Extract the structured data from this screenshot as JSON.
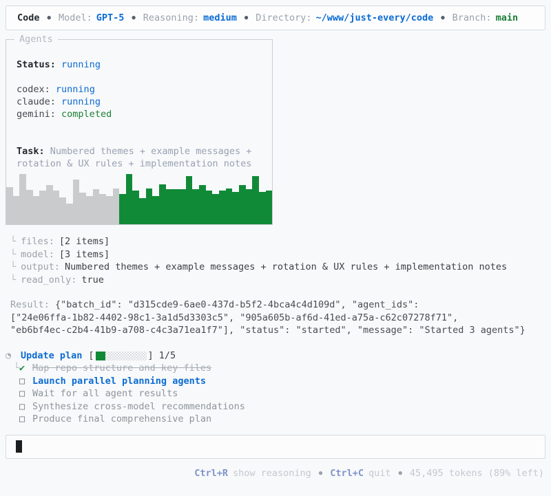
{
  "topbar": {
    "app": "Code",
    "sep": "●",
    "model_label": "Model:",
    "model_value": "GPT-5",
    "reasoning_label": "Reasoning:",
    "reasoning_value": "medium",
    "directory_label": "Directory:",
    "directory_value": "~/www/just-every/code",
    "branch_label": "Branch:",
    "branch_value": "main"
  },
  "agents_panel": {
    "title": "Agents",
    "status_label": "Status:",
    "status_value": "running",
    "agents": [
      {
        "name": "codex:",
        "status": "running"
      },
      {
        "name": "claude:",
        "status": "running"
      },
      {
        "name": "gemini:",
        "status": "completed"
      }
    ],
    "task_label": "Task:",
    "task_text": "Numbered themes + example messages + rotation & UX rules + implementation notes"
  },
  "chart_data": {
    "type": "bar",
    "title": "agent activity sparkline",
    "values": [
      68,
      52,
      92,
      63,
      52,
      62,
      72,
      62,
      50,
      38,
      82,
      58,
      52,
      64,
      56,
      52,
      66,
      56,
      92,
      62,
      48,
      66,
      52,
      74,
      64,
      64,
      64,
      88,
      64,
      72,
      62,
      56,
      62,
      66,
      60,
      72,
      64,
      88,
      60,
      62
    ],
    "split_index": 17,
    "bar_colors": {
      "past": "#c9cbcd",
      "recent": "#118a38"
    },
    "ylim": [
      0,
      100
    ],
    "xlabel": "",
    "ylabel": ""
  },
  "tree": {
    "glyph": "└",
    "items": [
      {
        "key": "files:",
        "value": "[2 items]"
      },
      {
        "key": "model:",
        "value": "[3 items]"
      },
      {
        "key": "output:",
        "value": "Numbered themes + example messages + rotation & UX rules + implementation notes"
      },
      {
        "key": "read_only:",
        "value": "true"
      }
    ]
  },
  "result": {
    "label": "Result:",
    "lines": [
      "{\"batch_id\": \"d315cde9-6ae0-437d-b5f2-4bca4c4d109d\", \"agent_ids\":",
      "[\"24e06ffa-1b82-4402-98c1-3a1d5d3303c5\", \"905a605b-af6d-41ed-a75a-c62c07278f71\",",
      "\"eb6bf4ec-c2b4-41b9-a708-c4c3a71ea1f7\"], \"status\": \"started\", \"message\": \"Started 3 agents\"}"
    ]
  },
  "plan": {
    "icon": "◔",
    "title": "Update plan",
    "bracket_open": "[",
    "bracket_close": "]",
    "completed": 1,
    "total": 5,
    "fraction": "1/5",
    "tree_glyph": "└",
    "items": [
      {
        "mark": "✔",
        "state": "done",
        "label": "Map repo structure and key files"
      },
      {
        "mark": "□",
        "state": "active",
        "label": "Launch parallel planning agents"
      },
      {
        "mark": "□",
        "state": "pending",
        "label": "Wait for all agent results"
      },
      {
        "mark": "□",
        "state": "pending",
        "label": "Synthesize cross-model recommendations"
      },
      {
        "mark": "□",
        "state": "pending",
        "label": "Produce final comprehensive plan"
      }
    ]
  },
  "footer": {
    "sep": "●",
    "shortcut_1_key": "Ctrl+R",
    "shortcut_1_label": "show reasoning",
    "shortcut_2_key": "Ctrl+C",
    "shortcut_2_label": "quit",
    "tokens": "45,495 tokens (89% left)"
  },
  "colors": {
    "accent_blue": "#0b6bd3",
    "text_green": "#1a7f37",
    "bar_green": "#118a38",
    "bar_gray": "#c9cbcd"
  }
}
